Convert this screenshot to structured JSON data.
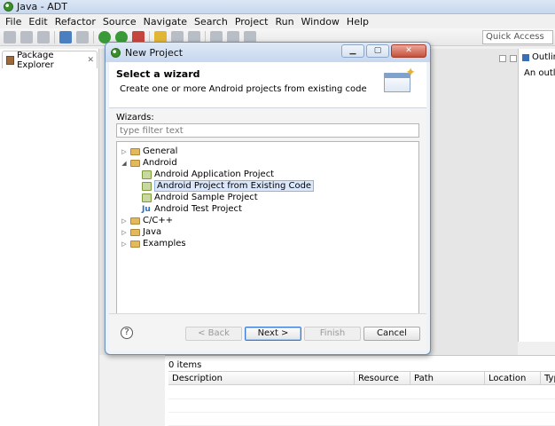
{
  "window": {
    "title": "Java - ADT"
  },
  "menu": [
    "File",
    "Edit",
    "Refactor",
    "Source",
    "Navigate",
    "Search",
    "Project",
    "Run",
    "Window",
    "Help"
  ],
  "quick_access": {
    "placeholder": "Quick Access"
  },
  "left_panel": {
    "tab_label": "Package Explorer"
  },
  "right_panel": {
    "tab_label": "Outlin",
    "text": "An outlin"
  },
  "bottom_panel": {
    "items_count": "0 items",
    "columns": [
      "Description",
      "Resource",
      "Path",
      "Location",
      "Typ"
    ]
  },
  "dialog": {
    "title": "New Project",
    "header": {
      "title": "Select a wizard",
      "description": "Create one or more Android projects from existing code"
    },
    "wizards_label": "Wizards:",
    "filter": {
      "placeholder": "type filter text"
    },
    "tree": {
      "general": "General",
      "android": "Android",
      "android_children": [
        "Android Application Project",
        "Android Project from Existing Code",
        "Android Sample Project",
        "Android Test Project"
      ],
      "cpp": "C/C++",
      "java": "Java",
      "examples": "Examples"
    },
    "buttons": {
      "back": "< Back",
      "next": "Next >",
      "finish": "Finish",
      "cancel": "Cancel"
    },
    "help_symbol": "?"
  }
}
